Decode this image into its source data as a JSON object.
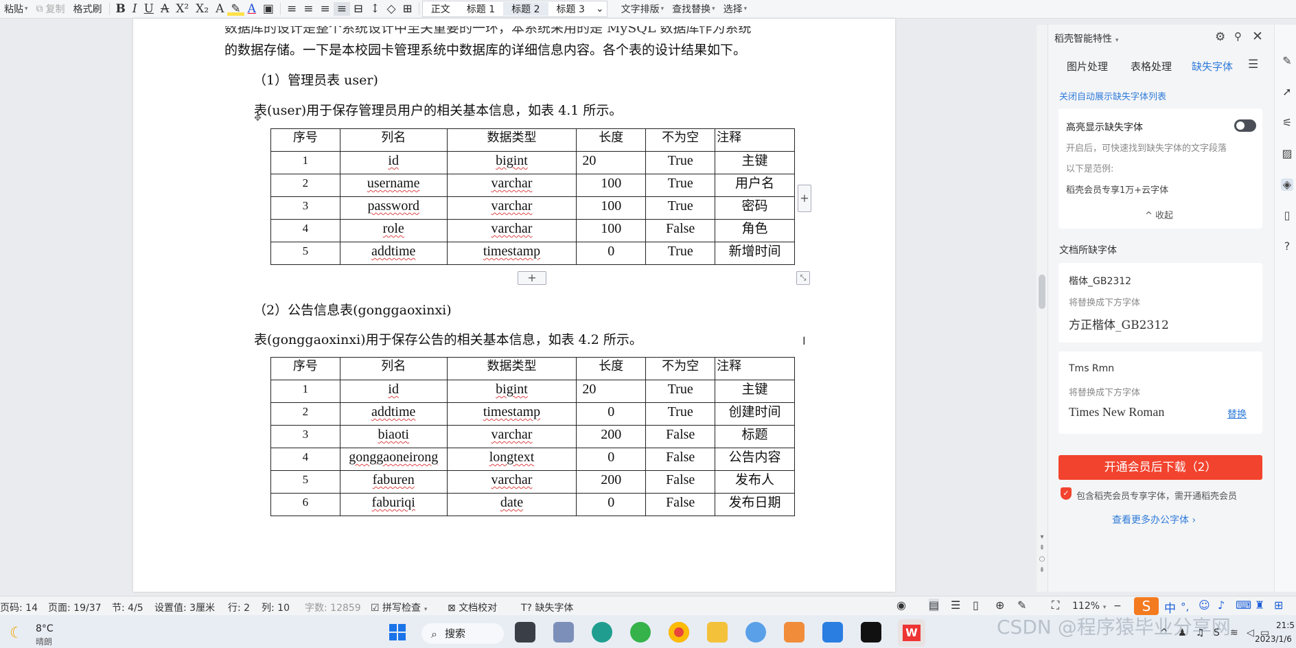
{
  "toolbar": {
    "paste": "粘贴",
    "copy": "复制",
    "format_painter": "格式刷",
    "styles": [
      "正文",
      "标题 1",
      "标题 2",
      "标题 3"
    ],
    "text_layout": "文字排版",
    "find_replace": "查找替换",
    "select": "选择"
  },
  "doc": {
    "intro_line": "的数据存储。一下是本校园卡管理系统中数据库的详细信息内容。各个表的设计结果如下。",
    "section1_title": "（1）管理员表 user)",
    "section1_desc": "表(user)用于保存管理员用户的相关基本信息，如表 4.1 所示。",
    "section2_title": "（2）公告信息表(gonggaoxinxi)",
    "section2_desc": "表(gonggaoxinxi)用于保存公告的相关基本信息，如表 4.2 所示。",
    "table_headers": [
      "序号",
      "列名",
      "数据类型",
      "长度",
      "不为空",
      "注释"
    ],
    "table1_rows": [
      {
        "no": "1",
        "name": "id",
        "type": "bigint",
        "len": "20",
        "nn": "True",
        "note": "主键"
      },
      {
        "no": "2",
        "name": "username",
        "type": "varchar",
        "len": "100",
        "nn": "True",
        "note": "用户名"
      },
      {
        "no": "3",
        "name": "password",
        "type": "varchar",
        "len": "100",
        "nn": "True",
        "note": "密码"
      },
      {
        "no": "4",
        "name": "role",
        "type": "varchar",
        "len": "100",
        "nn": "False",
        "note": "角色"
      },
      {
        "no": "5",
        "name": "addtime",
        "type": "timestamp",
        "len": "0",
        "nn": "True",
        "note": "新增时间"
      }
    ],
    "table2_rows": [
      {
        "no": "1",
        "name": "id",
        "type": "bigint",
        "len": "20",
        "nn": "True",
        "note": "主键"
      },
      {
        "no": "2",
        "name": "addtime",
        "type": "timestamp",
        "len": "0",
        "nn": "True",
        "note": "创建时间"
      },
      {
        "no": "3",
        "name": "biaoti",
        "type": "varchar",
        "len": "200",
        "nn": "False",
        "note": "标题"
      },
      {
        "no": "4",
        "name": "gonggaoneirong",
        "type": "longtext",
        "len": "0",
        "nn": "False",
        "note": "公告内容"
      },
      {
        "no": "5",
        "name": "faburen",
        "type": "varchar",
        "len": "200",
        "nn": "False",
        "note": "发布人"
      },
      {
        "no": "6",
        "name": "faburiqi",
        "type": "date",
        "len": "0",
        "nn": "False",
        "note": "发布日期"
      }
    ]
  },
  "panel": {
    "title": "稻壳智能特性",
    "tabs": [
      "图片处理",
      "表格处理",
      "缺失字体"
    ],
    "close_auto_link": "关闭自动展示缺失字体列表",
    "highlight_title": "高亮显示缺失字体",
    "highlight_desc": "开启后，可快速找到缺失字体的文字段落",
    "example_label": "以下是范例:",
    "example_text": "稻壳会员专享1万+云字体",
    "collapse": "收起",
    "missing_fonts_title": "文档所缺字体",
    "font1_name": "楷体_GB2312",
    "replace_with_label": "将替换成下方字体",
    "font1_replacement": "方正楷体_GB2312",
    "font2_name": "Tms Rmn",
    "font2_replacement": "Times New Roman",
    "replace_link": "替换",
    "vip_button": "开通会员后下载（2）",
    "vip_note": "包含稻壳会员专享字体，需开通稻壳会员",
    "more_fonts_link": "查看更多办公字体 ›"
  },
  "status": {
    "page_code": "页码: 14",
    "page": "页面: 19/37",
    "section": "节: 4/5",
    "setting": "设置值: 3厘米",
    "row": "行: 2",
    "col": "列: 10",
    "word_count": "字数: 12859",
    "spell_check": "拼写检查",
    "proofread": "文档校对",
    "missing_font": "缺失字体",
    "zoom": "112%"
  },
  "taskbar": {
    "temperature": "8°C",
    "weather": "晴朗",
    "search": "搜索",
    "watermark": "CSDN @程序猿毕业分享网",
    "time": "21:5",
    "date": "2023/1/6"
  },
  "colors": {
    "vip_red": "#f2432e",
    "link_blue": "#2f7bd9"
  }
}
